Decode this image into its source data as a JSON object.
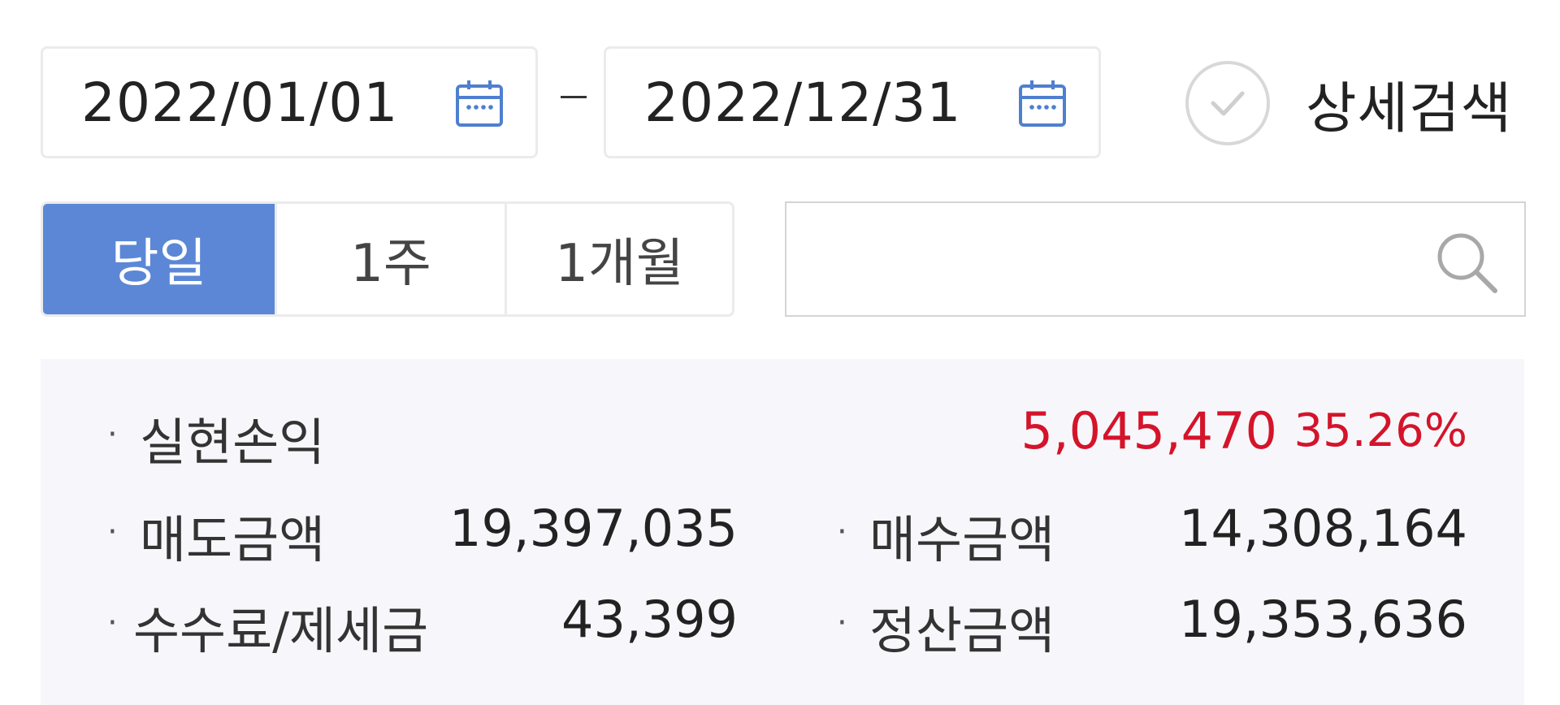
{
  "date_range": {
    "start": "2022/01/01",
    "end": "2022/12/31",
    "calendar_icon": "calendar-icon",
    "separator": "-"
  },
  "detail_search": {
    "label": "상세검색",
    "checked": false,
    "icon": "check-icon"
  },
  "period_tabs": [
    {
      "label": "당일",
      "active": true
    },
    {
      "label": "1주",
      "active": false
    },
    {
      "label": "1개월",
      "active": false
    }
  ],
  "search": {
    "value": "",
    "placeholder": "",
    "icon": "search-icon"
  },
  "summary": {
    "realized_pnl": {
      "label": "실현손익",
      "value": "5,045,470",
      "percent": "35.26%"
    },
    "sell_amount": {
      "label": "매도금액",
      "value": "19,397,035"
    },
    "buy_amount": {
      "label": "매수금액",
      "value": "14,308,164"
    },
    "fees_taxes": {
      "label": "수수료/제세금",
      "value": "43,399"
    },
    "settlement_amount": {
      "label": "정산금액",
      "value": "19,353,636"
    }
  },
  "colors": {
    "accent": "#5b87d6",
    "profit": "#d4142a",
    "panel_bg": "#f7f7fb",
    "border": "#ebebeb"
  }
}
